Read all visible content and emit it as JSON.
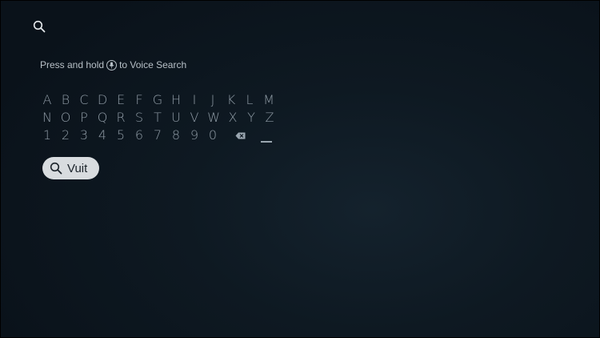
{
  "header": {
    "search_icon": "search-icon"
  },
  "hint": {
    "prefix": "Press and hold",
    "mic_icon": "microphone-icon",
    "suffix": "to Voice Search"
  },
  "keyboard": {
    "row1": [
      "A",
      "B",
      "C",
      "D",
      "E",
      "F",
      "G",
      "H",
      "I",
      "J",
      "K",
      "L",
      "M"
    ],
    "row2": [
      "N",
      "O",
      "P",
      "Q",
      "R",
      "S",
      "T",
      "U",
      "V",
      "W",
      "X",
      "Y",
      "Z"
    ],
    "row3": [
      "1",
      "2",
      "3",
      "4",
      "5",
      "6",
      "7",
      "8",
      "9",
      "0"
    ],
    "backspace_icon": "backspace-icon",
    "space_icon": "space-icon"
  },
  "query": {
    "icon": "search-icon",
    "text": "Vuit"
  },
  "colors": {
    "background": "#0e1922",
    "key_text": "#8f9ba5",
    "pill_background": "#d8dcdf"
  }
}
